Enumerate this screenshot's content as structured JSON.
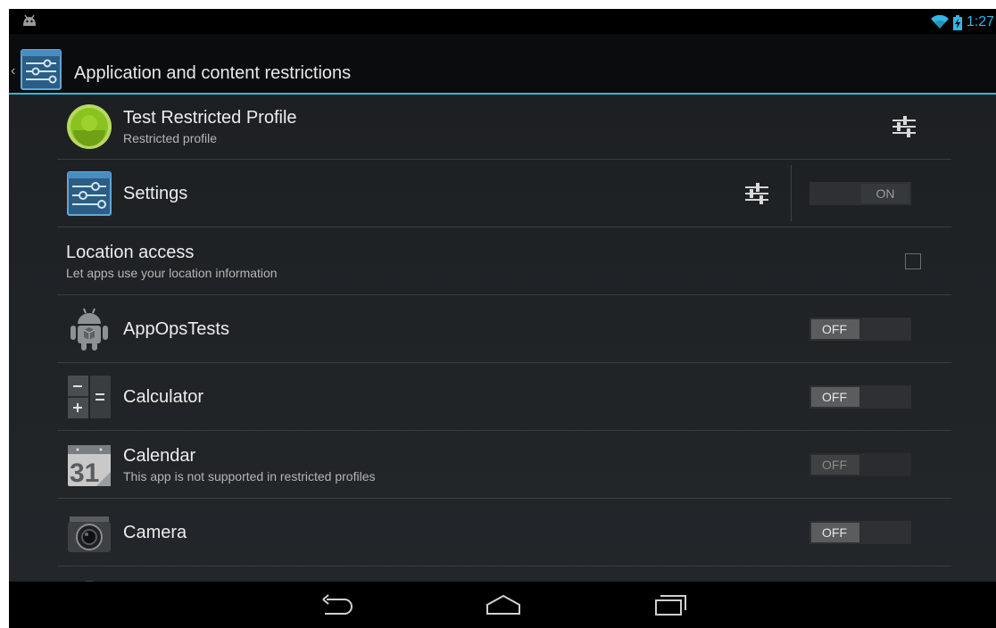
{
  "status_bar": {
    "time": "1:27"
  },
  "action_bar": {
    "title": "Application and content restrictions"
  },
  "profile": {
    "name": "Test Restricted Profile",
    "subtitle": "Restricted profile"
  },
  "settings_row": {
    "title": "Settings",
    "toggle": "ON"
  },
  "location": {
    "title": "Location access",
    "subtitle": "Let apps use your location information",
    "checked": false
  },
  "apps": [
    {
      "name": "AppOpsTests",
      "toggle": "OFF"
    },
    {
      "name": "Calculator",
      "toggle": "OFF"
    },
    {
      "name": "Calendar",
      "subtitle": "This app is not supported in restricted profiles",
      "toggle": "OFF",
      "icon_text": "31"
    },
    {
      "name": "Camera",
      "toggle": "OFF"
    }
  ],
  "colors": {
    "accent": "#33b5e5",
    "background": "#1f2326",
    "profile_green": "#8ac21f"
  }
}
